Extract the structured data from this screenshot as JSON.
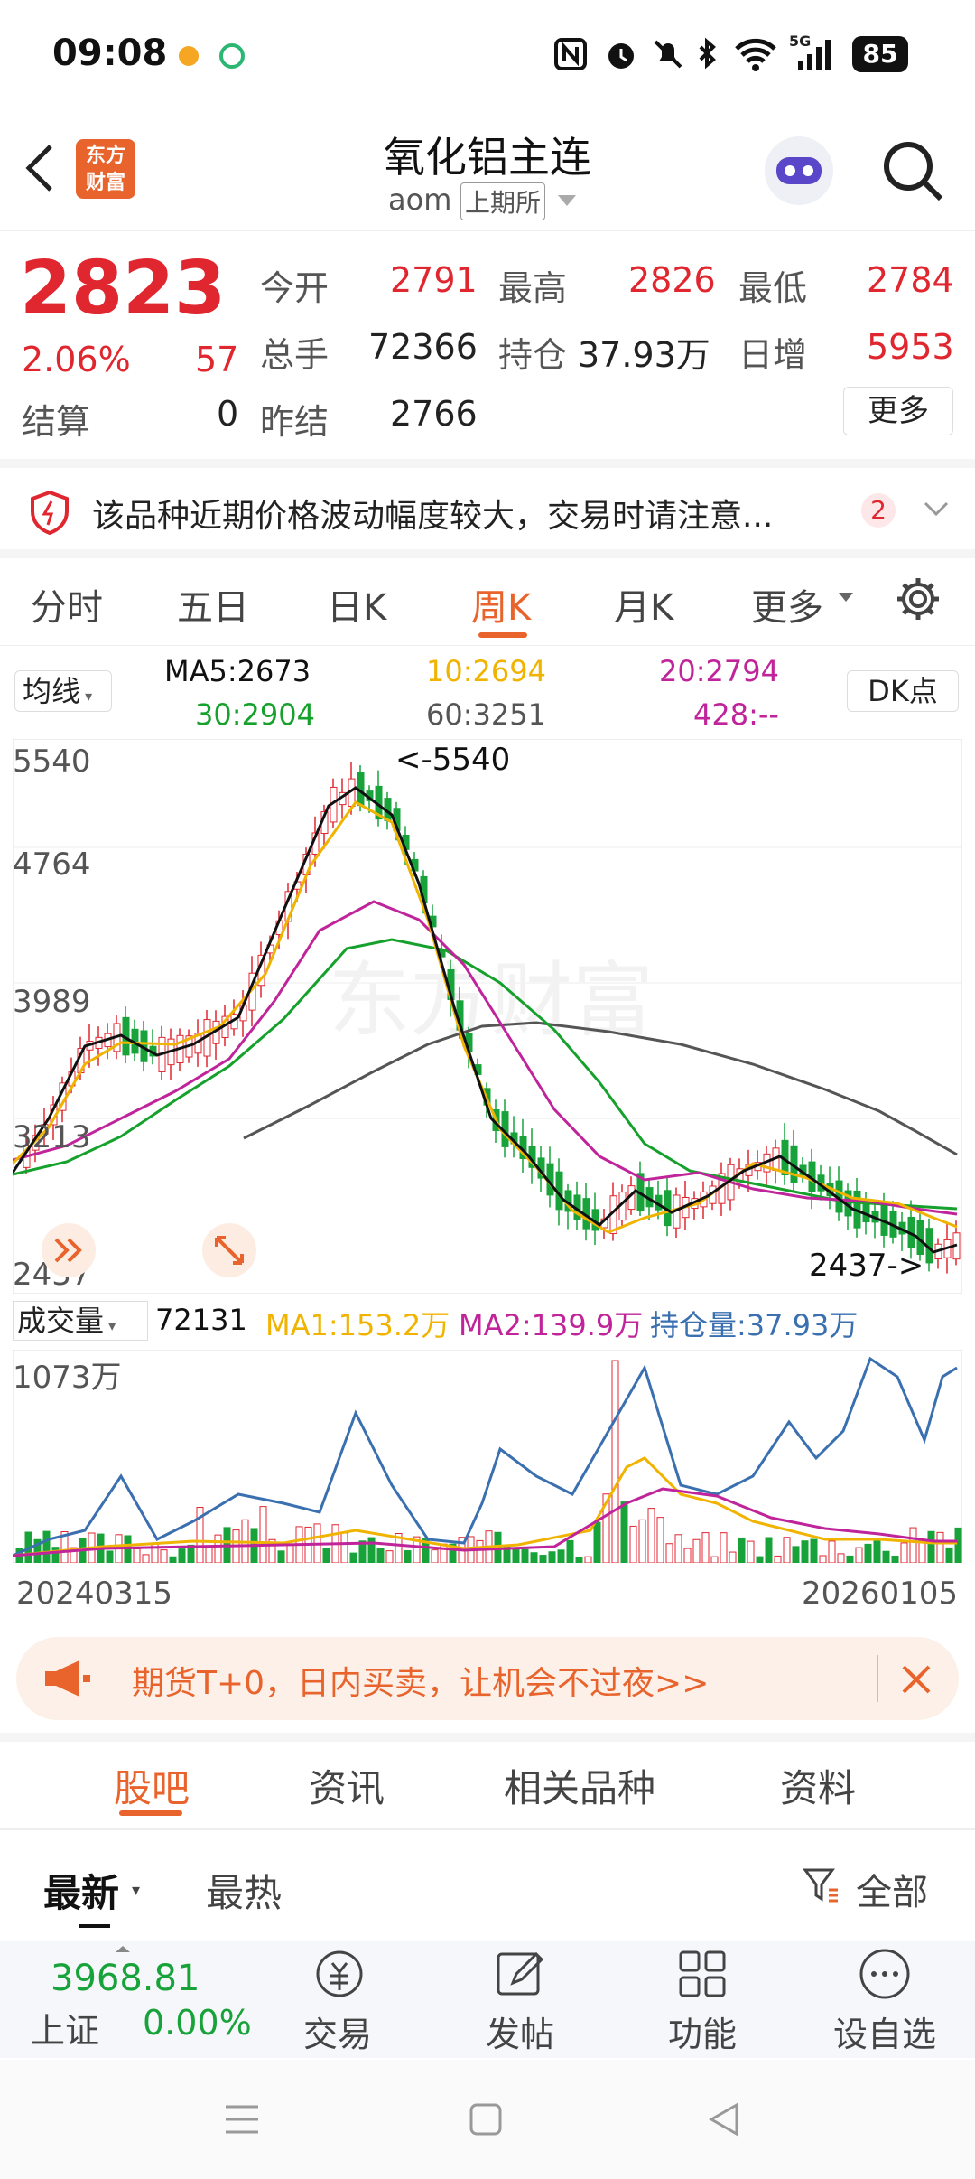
{
  "status": {
    "time": "09:08",
    "network": "5G",
    "battery": "85"
  },
  "header": {
    "title": "氧化铝主连",
    "code": "aom",
    "exchange": "上期所",
    "logo_line1": "东方",
    "logo_line2": "财富"
  },
  "quote": {
    "price": "2823",
    "change_pct": "2.06%",
    "change": "57",
    "settle_label": "结算",
    "settle_value": "0",
    "open_label": "今开",
    "open": "2791",
    "high_label": "最高",
    "high": "2826",
    "low_label": "最低",
    "low": "2784",
    "volume_label": "总手",
    "volume": "72366",
    "oi_label": "持仓",
    "oi": "37.93万",
    "daily_inc_label": "日增",
    "daily_inc": "5953",
    "prev_label": "昨结",
    "prev": "2766",
    "more_label": "更多"
  },
  "notice": {
    "text": "该品种近期价格波动幅度较大，交易时请注意...",
    "count": "2"
  },
  "tabs": [
    {
      "label": "分时"
    },
    {
      "label": "五日"
    },
    {
      "label": "日K"
    },
    {
      "label": "周K"
    },
    {
      "label": "月K"
    },
    {
      "label": "更多"
    }
  ],
  "active_tab": "周K",
  "ma": {
    "dropdown": "均线",
    "ma5": "MA5:2673",
    "ma10": "10:2694",
    "ma20": "20:2794",
    "ma30": "30:2904",
    "ma60": "60:3251",
    "ma428": "428:--",
    "dk": "DK点"
  },
  "price_axis": {
    "labels": [
      "5540",
      "4764",
      "3989",
      "3213",
      "2437"
    ],
    "high_marker": "<-5540",
    "low_marker": "2437->"
  },
  "volume_header": {
    "dropdown": "成交量",
    "vol": "72131",
    "ma1": "MA1:153.2万",
    "ma2": "MA2:139.9万",
    "oi": "持仓量:37.93万"
  },
  "volume_axis": {
    "max": "1073万"
  },
  "dates": {
    "start": "20240315",
    "end": "20260105"
  },
  "chart_data": {
    "type": "candlestick",
    "series": [
      {
        "name": "MA5",
        "last": 2673
      },
      {
        "name": "10",
        "last": 2694
      },
      {
        "name": "20",
        "last": 2794
      },
      {
        "name": "30",
        "last": 2904
      },
      {
        "name": "60",
        "last": 3251
      }
    ],
    "ylim": [
      2437,
      5540
    ],
    "high": 5540,
    "low": 2437
  },
  "promo": {
    "text": "期货T+0，日内买卖，让机会不过夜>>"
  },
  "subtabs": [
    {
      "label": "股吧"
    },
    {
      "label": "资讯"
    },
    {
      "label": "相关品种"
    },
    {
      "label": "资料"
    }
  ],
  "filters": {
    "latest": "最新",
    "hot": "最热",
    "all": "全部"
  },
  "index": {
    "value": "3968.81",
    "name": "上证",
    "change": "0.00%"
  },
  "bottom_nav": [
    {
      "label": "交易"
    },
    {
      "label": "发帖"
    },
    {
      "label": "功能"
    },
    {
      "label": "设自选"
    }
  ],
  "colors": {
    "up": "#e0262f",
    "down": "#18a33a",
    "accent": "#e8642c",
    "ma5": "#111111",
    "ma10": "#f0b400",
    "ma20": "#c0249a",
    "ma30": "#16a02c",
    "ma60": "#555555"
  }
}
